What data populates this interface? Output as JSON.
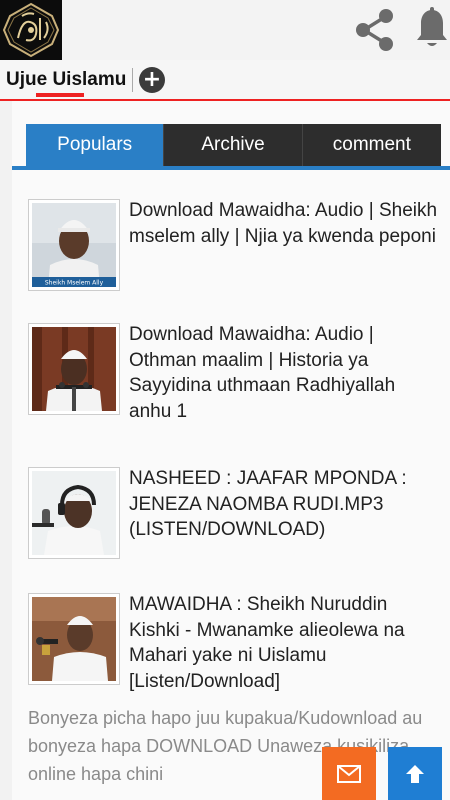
{
  "header": {
    "logo_icon": "calligraphy-logo",
    "share_icon": "share-icon",
    "bell_icon": "bell-icon"
  },
  "tabstrip": {
    "site_tab_label": "Ujue Uislamu",
    "add_tab_label": "+"
  },
  "tabs": [
    {
      "label": "Populars",
      "active": true
    },
    {
      "label": "Archive",
      "active": false
    },
    {
      "label": "comment",
      "active": false
    }
  ],
  "posts": [
    {
      "title": "Download Mawaidha: Audio | Sheikh mselem ally | Njia ya kwenda peponi",
      "thumb_caption": "Sheikh Mselem Ally"
    },
    {
      "title": "Download Mawaidha: Audio | Othman maalim | Historia ya Sayyidina uthmaan Radhiyallah anhu 1"
    },
    {
      "title": "NASHEED : JAAFAR MPONDA : JENEZA NAOMBA RUDI.MP3 (LISTEN/DOWNLOAD)"
    },
    {
      "title": "MAWAIDHA : Sheikh Nuruddin Kishki - Mwanamke alieolewa na Mahari yake ni Uislamu [Listen/Download]"
    }
  ],
  "note": "Bonyeza picha hapo juu kupakua/Kudownload au bonyeza hapa  DOWNLOAD  Unaweza kusikiliza online hapa chini",
  "colors": {
    "accent": "#2a7fc6",
    "red": "#e22222",
    "mail_button": "#f36b22",
    "up_button": "#1f7ed3"
  }
}
